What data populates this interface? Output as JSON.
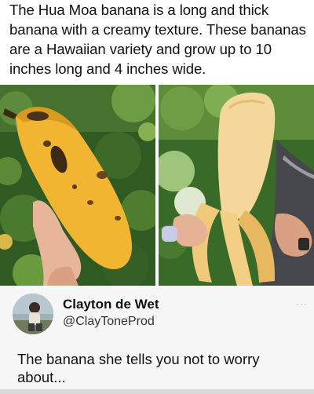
{
  "post": {
    "caption": "The Hua Moa banana is a long and thick banana with a creamy texture. These bananas are a Hawaiian variety and grow up to 10 inches long and 4 inches wide."
  },
  "photos": {
    "left": "photo-unpeeled-banana",
    "right": "photo-peeled-banana"
  },
  "tweet": {
    "author_name": "Clayton de Wet",
    "author_handle": "@ClayToneProd",
    "more_label": "···",
    "text": "The banana she tells you not to worry about..."
  },
  "colors": {
    "banana_yellow": "#f2b531",
    "banana_flesh": "#f3d79b",
    "foliage": "#3f6d2a",
    "road": "#4a4c52",
    "tweet_background": "#f7f7f7"
  }
}
